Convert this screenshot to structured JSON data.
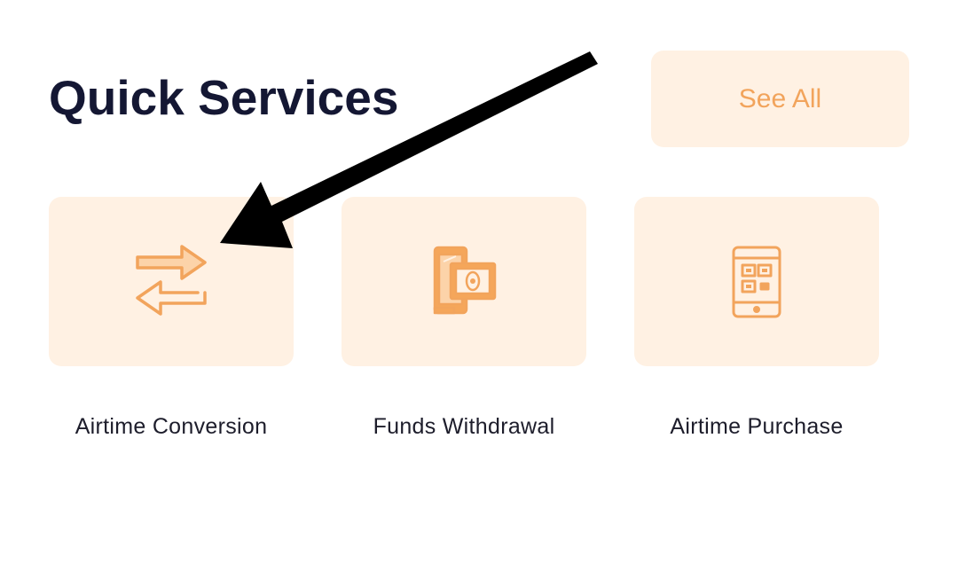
{
  "header": {
    "title": "Quick Services",
    "see_all_label": "See All"
  },
  "services": [
    {
      "label": "Airtime Conversion",
      "icon": "exchange-arrows-icon"
    },
    {
      "label": "Funds Withdrawal",
      "icon": "phone-cash-icon"
    },
    {
      "label": "Airtime Purchase",
      "icon": "phone-qr-icon"
    }
  ],
  "colors": {
    "accent": "#f2a45c",
    "tile_background": "#fff1e3",
    "title": "#141733",
    "label": "#1d1d2b",
    "annotation_arrow": "#000000"
  },
  "annotation": {
    "icon": "annotation-arrow-icon",
    "points_to": "Airtime Conversion"
  }
}
